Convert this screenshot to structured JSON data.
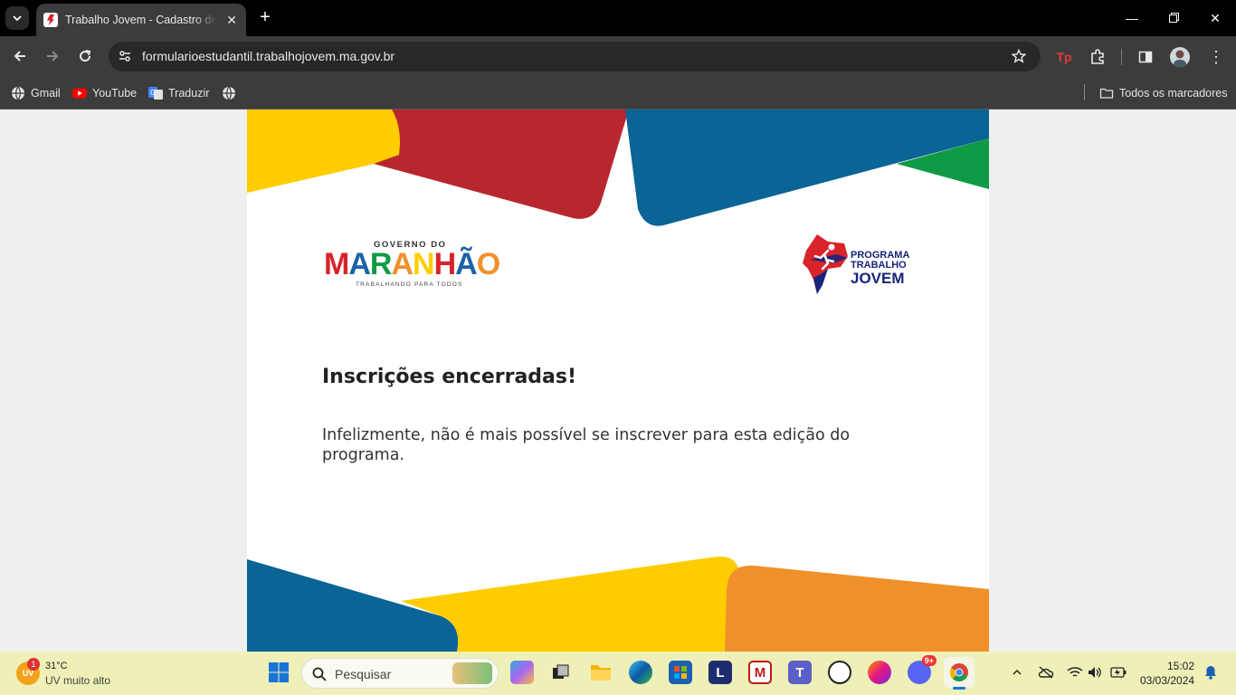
{
  "browser": {
    "tab_title": "Trabalho Jovem - Cadastro de estudantes",
    "url": "formularioestudantil.trabalhojovem.ma.gov.br",
    "bookmarks": [
      {
        "label": "Gmail",
        "icon": "globe-icon"
      },
      {
        "label": "YouTube",
        "icon": "youtube-icon"
      },
      {
        "label": "Traduzir",
        "icon": "translate-icon"
      },
      {
        "label": "",
        "icon": "globe-icon"
      }
    ],
    "all_bookmarks_label": "Todos os marcadores"
  },
  "page": {
    "logo_left": {
      "top": "GOVERNO DO",
      "main": "MARANHÃO",
      "bottom": "TRABALHANDO PARA TODOS"
    },
    "logo_right": {
      "line1": "PROGRAMA",
      "line2": "TRABALHO",
      "line3": "JOVEM"
    },
    "heading": "Inscrições encerradas!",
    "message": "Infelizmente, não é mais possível se inscrever para esta edição do programa."
  },
  "taskbar": {
    "weather_temp": "31°C",
    "weather_desc": "UV muito alto",
    "weather_badge": "1",
    "weather_icon_label": "UV",
    "search_placeholder": "Pesquisar",
    "discord_badge": "9+",
    "time": "15:02",
    "date": "03/03/2024"
  },
  "colors": {
    "yellow": "#ffcc00",
    "red": "#b8272e",
    "blue": "#0a6496",
    "green": "#0f9a45",
    "orange": "#f0902a"
  }
}
